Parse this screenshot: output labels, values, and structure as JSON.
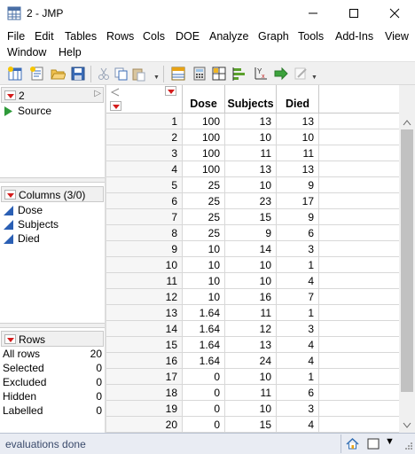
{
  "window": {
    "title": "2 - JMP"
  },
  "menu": [
    "File",
    "Edit",
    "Tables",
    "Rows",
    "Cols",
    "DOE",
    "Analyze",
    "Graph",
    "Tools",
    "Add-Ins",
    "View",
    "Window",
    "Help"
  ],
  "table_panel": {
    "name": "2",
    "items": [
      {
        "label": "Source",
        "icon": "play-triangle-icon"
      }
    ]
  },
  "columns_panel": {
    "header": "Columns (3/0)",
    "items": [
      {
        "label": "Dose"
      },
      {
        "label": "Subjects"
      },
      {
        "label": "Died"
      }
    ]
  },
  "rows_panel": {
    "header": "Rows",
    "items": [
      {
        "label": "All rows",
        "value": "20"
      },
      {
        "label": "Selected",
        "value": "0"
      },
      {
        "label": "Excluded",
        "value": "0"
      },
      {
        "label": "Hidden",
        "value": "0"
      },
      {
        "label": "Labelled",
        "value": "0"
      }
    ]
  },
  "grid": {
    "columns": [
      "Dose",
      "Subjects",
      "Died"
    ],
    "rows": [
      [
        "1",
        "100",
        "13",
        "13"
      ],
      [
        "2",
        "100",
        "10",
        "10"
      ],
      [
        "3",
        "100",
        "11",
        "11"
      ],
      [
        "4",
        "100",
        "13",
        "13"
      ],
      [
        "5",
        "25",
        "10",
        "9"
      ],
      [
        "6",
        "25",
        "23",
        "17"
      ],
      [
        "7",
        "25",
        "15",
        "9"
      ],
      [
        "8",
        "25",
        "9",
        "6"
      ],
      [
        "9",
        "10",
        "14",
        "3"
      ],
      [
        "10",
        "10",
        "10",
        "1"
      ],
      [
        "11",
        "10",
        "10",
        "4"
      ],
      [
        "12",
        "10",
        "16",
        "7"
      ],
      [
        "13",
        "1.64",
        "11",
        "1"
      ],
      [
        "14",
        "1.64",
        "12",
        "3"
      ],
      [
        "15",
        "1.64",
        "13",
        "4"
      ],
      [
        "16",
        "1.64",
        "24",
        "4"
      ],
      [
        "17",
        "0",
        "10",
        "1"
      ],
      [
        "18",
        "0",
        "11",
        "6"
      ],
      [
        "19",
        "0",
        "10",
        "3"
      ],
      [
        "20",
        "0",
        "15",
        "4"
      ]
    ]
  },
  "status": {
    "text": "evaluations done"
  }
}
